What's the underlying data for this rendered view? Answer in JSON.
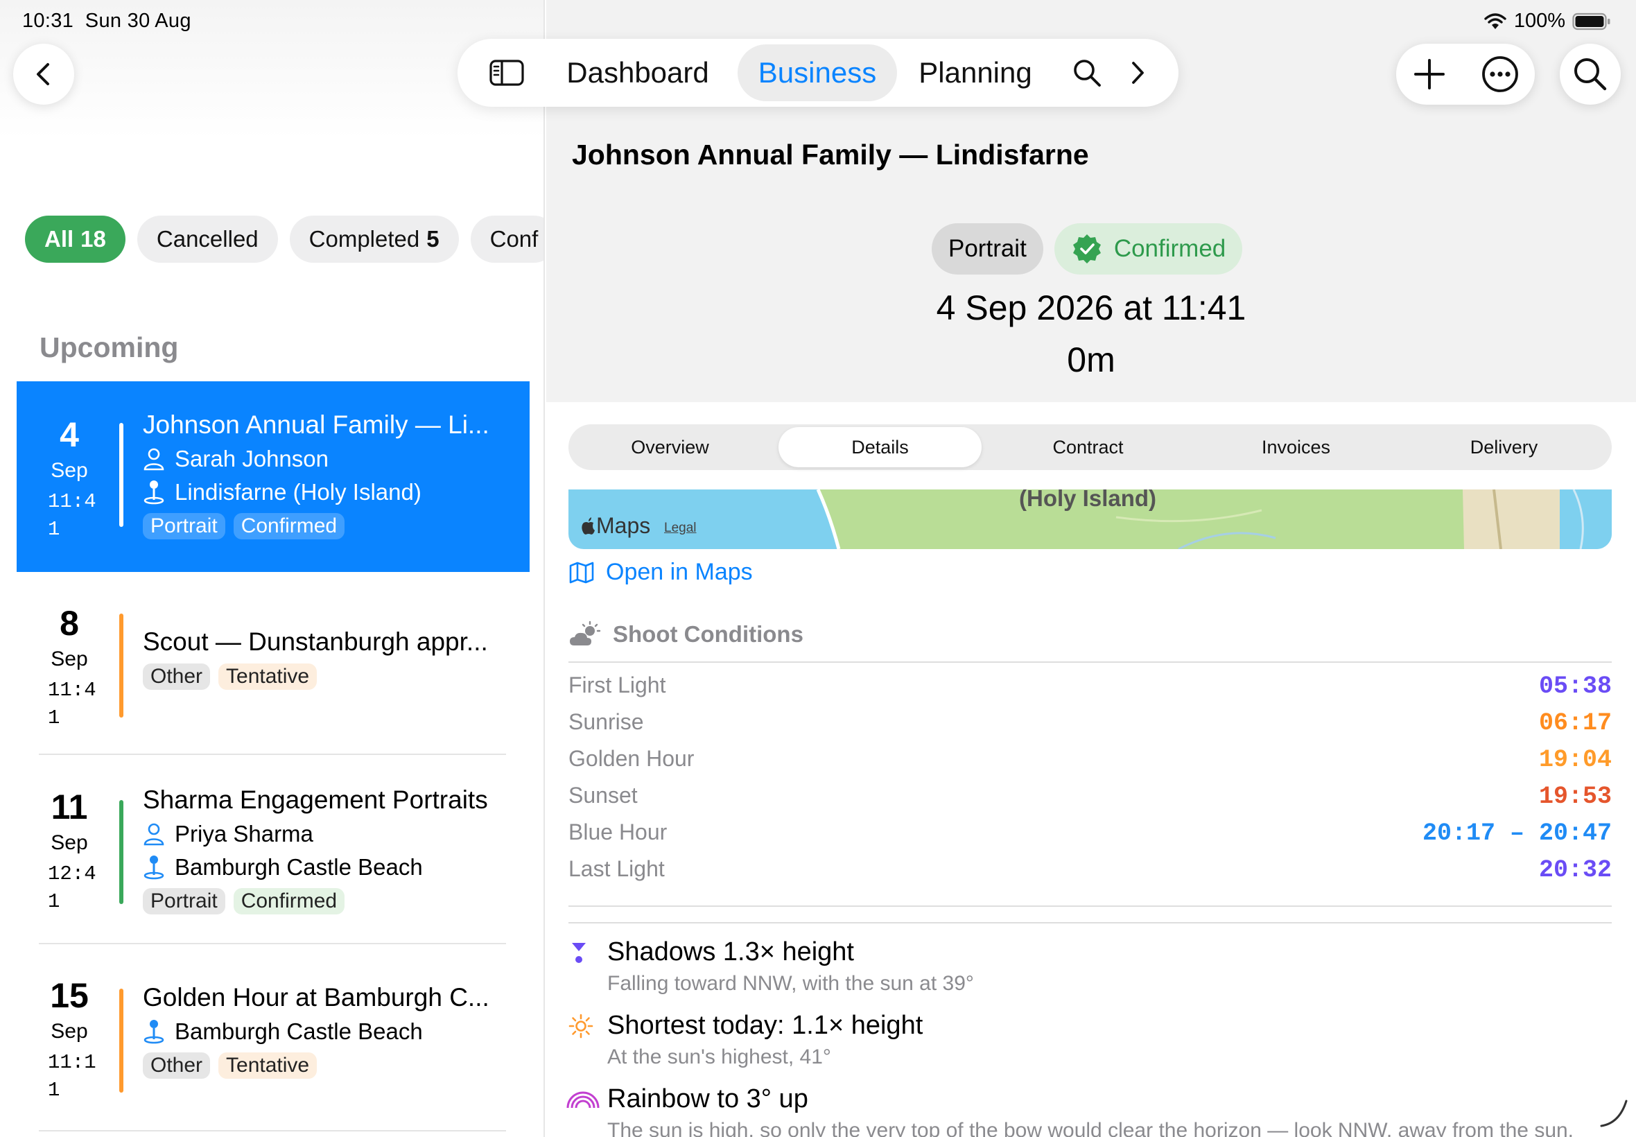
{
  "status_bar": {
    "time": "10:31",
    "date": "Sun 30 Aug",
    "battery": "100%"
  },
  "filters": [
    {
      "label": "All",
      "count": "18",
      "active": true
    },
    {
      "label": "Cancelled",
      "count": "",
      "active": false
    },
    {
      "label": "Completed",
      "count": "5",
      "active": false
    },
    {
      "label": "Conf",
      "count": "",
      "active": false
    }
  ],
  "sidebar": {
    "section_title": "Upcoming",
    "items": [
      {
        "day": "4",
        "month": "Sep",
        "time": "11:41",
        "title": "Johnson Annual Family — Li...",
        "client": "Sarah Johnson",
        "location": "Lindisfarne (Holy Island)",
        "type": "Portrait",
        "status": "Confirmed",
        "bar_color": "#ffffff",
        "selected": true
      },
      {
        "day": "8",
        "month": "Sep",
        "time": "11:41",
        "title": "Scout — Dunstanburgh appr...",
        "client": "",
        "location": "",
        "type": "Other",
        "status": "Tentative",
        "bar_color": "#ff9a2e",
        "selected": false
      },
      {
        "day": "11",
        "month": "Sep",
        "time": "12:41",
        "title": "Sharma Engagement Portraits",
        "client": "Priya Sharma",
        "location": "Bamburgh Castle Beach",
        "type": "Portrait",
        "status": "Confirmed",
        "bar_color": "#3aa85a",
        "selected": false
      },
      {
        "day": "15",
        "month": "Sep",
        "time": "11:11",
        "title": "Golden Hour at Bamburgh C...",
        "client": "",
        "location": "Bamburgh Castle Beach",
        "type": "Other",
        "status": "Tentative",
        "bar_color": "#ff9a2e",
        "selected": false
      }
    ]
  },
  "nav": {
    "tabs": [
      "Dashboard",
      "Business",
      "Planning"
    ],
    "active_tab": "Business"
  },
  "detail": {
    "title": "Johnson Annual Family — Lindisfarne",
    "type_pill": "Portrait",
    "status_pill": "Confirmed",
    "when": "4 Sep 2026 at 11:41",
    "duration": "0m",
    "segments": [
      "Overview",
      "Details",
      "Contract",
      "Invoices",
      "Delivery"
    ],
    "active_segment": "Details",
    "map": {
      "label": "(Holy Island)",
      "logo": "Maps",
      "legal": "Legal"
    },
    "open_in_maps": "Open in Maps",
    "conditions_title": "Shoot Conditions",
    "conditions": [
      {
        "label": "First Light",
        "value": "05:38",
        "color": "#6a4cf5"
      },
      {
        "label": "Sunrise",
        "value": "06:17",
        "color": "#ff8c1f"
      },
      {
        "label": "Golden Hour",
        "value": "19:04",
        "color": "#ff9b2a"
      },
      {
        "label": "Sunset",
        "value": "19:53",
        "color": "#e5552c"
      },
      {
        "label": "Blue Hour",
        "value": "20:17 – 20:47",
        "color": "#1f8bf5"
      },
      {
        "label": "Last Light",
        "value": "20:32",
        "color": "#6a4cf5"
      }
    ],
    "facts": [
      {
        "title": "Shadows 1.3× height",
        "subtitle": "Falling toward NNW, with the sun at 39°",
        "icon": "shadow-icon"
      },
      {
        "title": "Shortest today: 1.1× height",
        "subtitle": "At the sun's highest, 41°",
        "icon": "sun-icon"
      },
      {
        "title": "Rainbow to 3° up",
        "subtitle": "The sun is high, so only the very top of the bow would clear the horizon — look NNW, away from the sun.",
        "icon": "rainbow-icon"
      }
    ]
  },
  "colors": {
    "accent": "#0a84ff",
    "green": "#3aa85a",
    "orange": "#ff9a2e"
  }
}
